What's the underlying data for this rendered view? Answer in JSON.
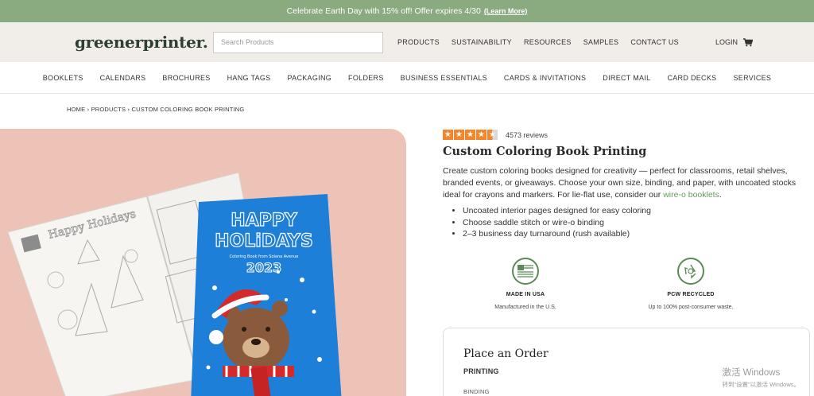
{
  "promo": {
    "text": "Celebrate Earth Day with 15% off! Offer expires 4/30",
    "link": "(Learn More)"
  },
  "header": {
    "logo": "greenerprinter.",
    "search_placeholder": "Search Products",
    "nav": [
      "PRODUCTS",
      "SUSTAINABILITY",
      "RESOURCES",
      "SAMPLES",
      "CONTACT US"
    ],
    "login": "LOGIN"
  },
  "categories": [
    "BOOKLETS",
    "CALENDARS",
    "BROCHURES",
    "HANG TAGS",
    "PACKAGING",
    "FOLDERS",
    "BUSINESS ESSENTIALS",
    "CARDS & INVITATIONS",
    "DIRECT MAIL",
    "CARD DECKS",
    "SERVICES"
  ],
  "breadcrumb": "HOME › PRODUCTS › CUSTOM COLORING BOOK PRINTING",
  "hero": {
    "inner_page_title": "Happy Holidays",
    "cover_title_1": "HAPPY",
    "cover_title_2": "HOLiDAYS",
    "cover_subtitle": "Coloring Book from Solana Avenue",
    "cover_year": "2023"
  },
  "product": {
    "rating": 4.5,
    "reviews": "4573 reviews",
    "title": "Custom Coloring Book Printing",
    "description": "Create custom coloring books designed for creativity — perfect for classrooms, retail shelves, branded events, or giveaways. Choose your own size, binding, and paper, with uncoated stocks ideal for crayons and markers. For lie-flat use, consider our",
    "description_link": "wire-o booklets",
    "description_end": ".",
    "bullets": [
      "Uncoated interior pages designed for easy coloring",
      "Choose saddle stitch or wire-o binding",
      "2–3 business day turnaround (rush available)"
    ],
    "badges": [
      {
        "icon": "usa-flag-icon",
        "title": "MADE IN USA",
        "sub": "Manufactured in the U.S."
      },
      {
        "icon": "recycle-icon",
        "title": "PCW RECYCLED",
        "sub": "Up to 100% post-consumer waste."
      }
    ]
  },
  "order": {
    "title": "Place an Order",
    "section": "PRINTING",
    "field": "BINDING"
  },
  "watermark": {
    "line1": "激活 Windows",
    "line2": "转到“设置”以激活 Windows。"
  },
  "colors": {
    "promo_bg": "#8aaa7f",
    "header_bg": "#f1ede8",
    "star": "#f4852b",
    "link": "#6a9a62",
    "hero_bg": "#ecc3b6",
    "cover_blue": "#1e7fd9"
  }
}
